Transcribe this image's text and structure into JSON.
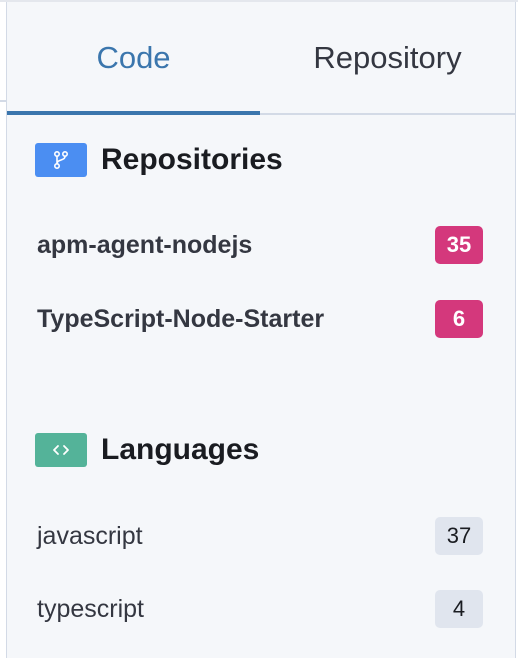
{
  "tabs": [
    {
      "label": "Code",
      "active": true
    },
    {
      "label": "Repository",
      "active": false
    }
  ],
  "repositories": {
    "title": "Repositories",
    "icon": "git-branch-icon",
    "items": [
      {
        "name": "apm-agent-nodejs",
        "count": "35"
      },
      {
        "name": "TypeScript-Node-Starter",
        "count": "6"
      }
    ]
  },
  "languages": {
    "title": "Languages",
    "icon": "code-brackets-icon",
    "items": [
      {
        "name": "javascript",
        "count": "37"
      },
      {
        "name": "typescript",
        "count": "4"
      }
    ]
  },
  "colors": {
    "accent": "#3b76ad",
    "repo_icon_bg": "#4b8ef2",
    "lang_icon_bg": "#54b399",
    "repo_badge": "#d4387c",
    "lang_badge": "#e0e5ee",
    "panel_bg": "#f5f7fa"
  }
}
